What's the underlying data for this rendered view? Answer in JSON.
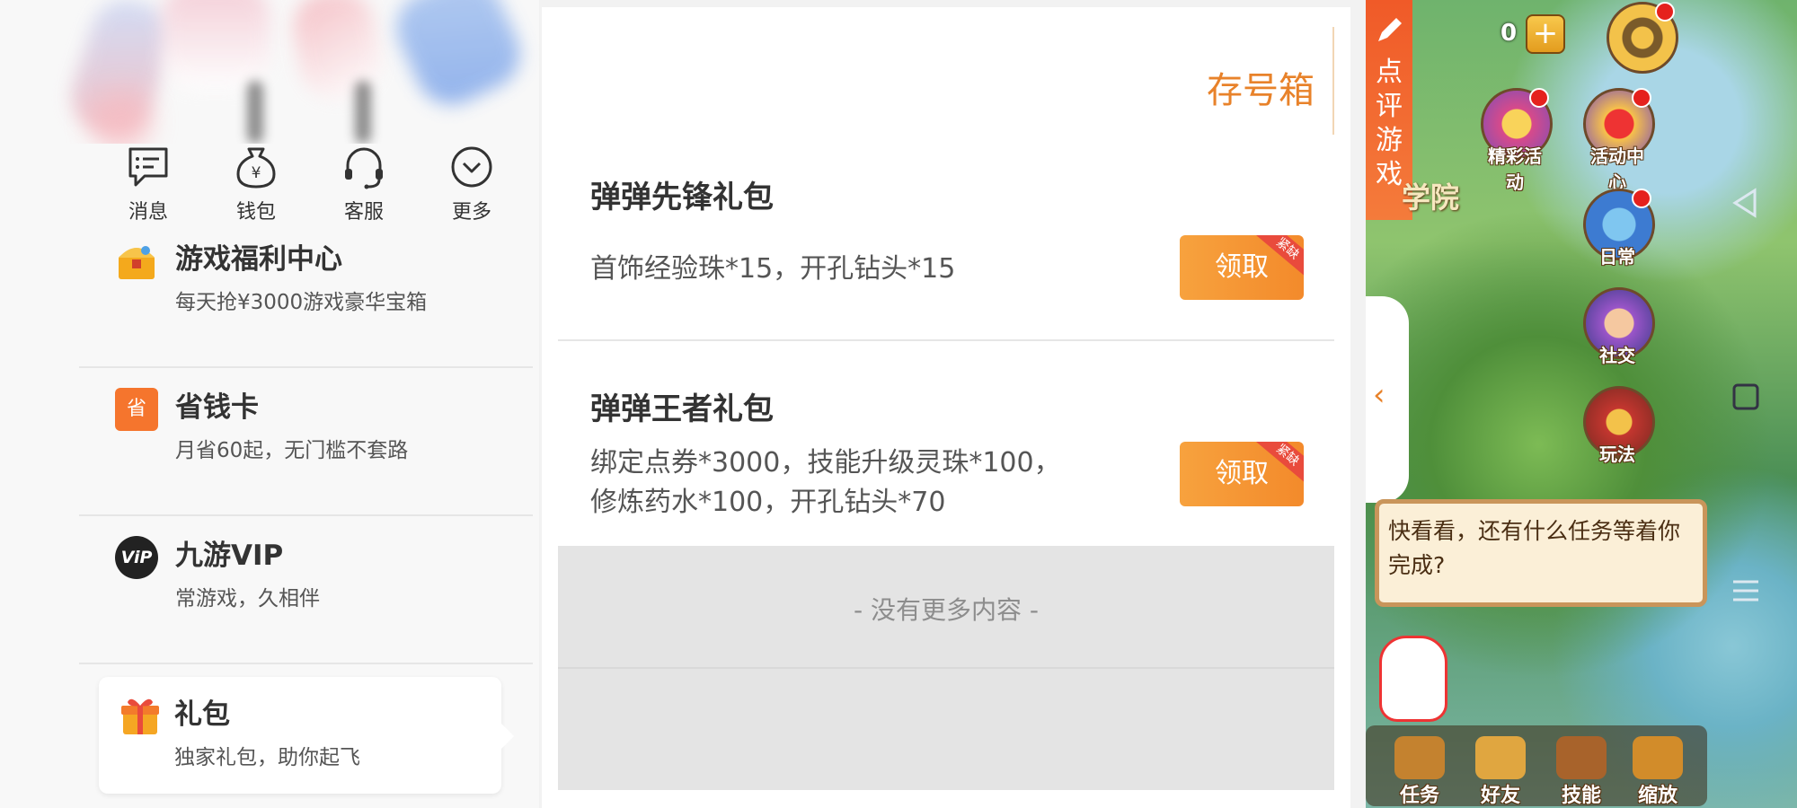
{
  "quick_actions": [
    {
      "label": "消息",
      "icon": "message-icon"
    },
    {
      "label": "钱包",
      "icon": "wallet-icon"
    },
    {
      "label": "客服",
      "icon": "headset-icon"
    },
    {
      "label": "更多",
      "icon": "more-icon"
    }
  ],
  "menu": [
    {
      "title": "游戏福利中心",
      "subtitle": "每天抢¥3000游戏豪华宝箱",
      "icon": "treasure-chest-icon"
    },
    {
      "title": "省钱卡",
      "subtitle": "月省60起，无门槛不套路",
      "icon": "save-card-icon",
      "icon_text": "省"
    },
    {
      "title": "九游VIP",
      "subtitle": "常游戏，久相伴",
      "icon": "vip-icon",
      "icon_text": "ViP"
    },
    {
      "title": "礼包",
      "subtitle": "独家礼包，助你起飞",
      "icon": "gift-icon",
      "active": true
    }
  ],
  "gifts_panel": {
    "save_box": "存号箱",
    "gifts": [
      {
        "name": "弹弹先锋礼包",
        "desc_lines": [
          "首饰经验珠*15，开孔钻头*15"
        ],
        "button": "领取",
        "tag": "紧缺"
      },
      {
        "name": "弹弹王者礼包",
        "desc_lines": [
          "绑定点券*3000，技能升级灵珠*100，",
          "修炼药水*100，开孔钻头*70"
        ],
        "button": "领取",
        "tag": "紧缺"
      }
    ],
    "no_more": "- 没有更多内容 -"
  },
  "game": {
    "review_tab": [
      "点",
      "评",
      "游",
      "戏"
    ],
    "gold": "0",
    "plus": "+",
    "academy_label": "学院",
    "side_buttons": [
      {
        "label": "精彩活动",
        "icon": "events-icon",
        "dot": true
      },
      {
        "label": "活动中心",
        "icon": "activity-center-icon",
        "dot": true
      },
      {
        "label": "日常",
        "icon": "daily-icon",
        "dot": true
      },
      {
        "label": "社交",
        "icon": "social-icon",
        "dot": false
      },
      {
        "label": "玩法",
        "icon": "gameplay-icon",
        "dot": false
      }
    ],
    "speech": "快看看，还有什么任务等着你完成?",
    "bottom_buttons": [
      {
        "label": "任务",
        "icon": "task-icon"
      },
      {
        "label": "好友",
        "icon": "friends-icon"
      },
      {
        "label": "技能",
        "icon": "skills-icon"
      },
      {
        "label": "缩放",
        "icon": "zoom-icon"
      }
    ]
  },
  "colors": {
    "accent": "#e8822a",
    "button": "#f38a2b",
    "tag": "#e94b3c"
  }
}
